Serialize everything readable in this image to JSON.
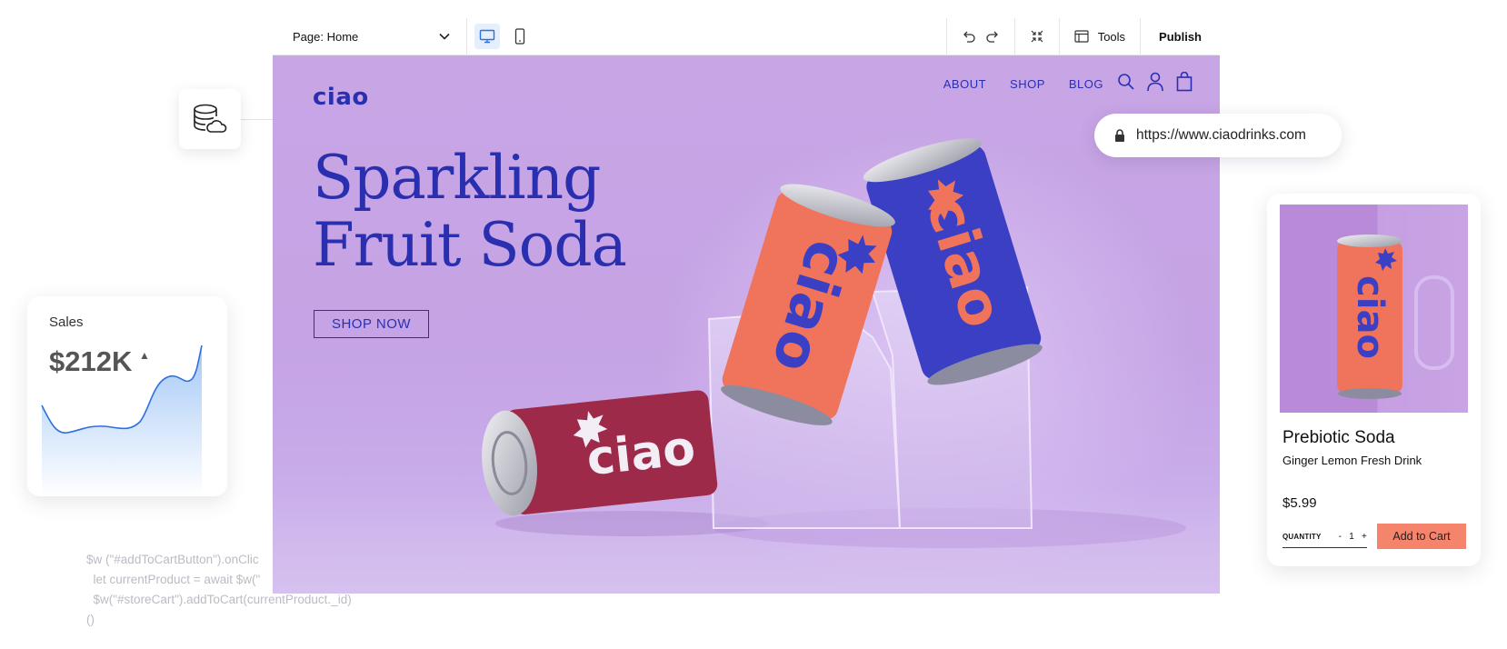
{
  "editor": {
    "page_select": "Page: Home",
    "tools_label": "Tools",
    "publish_label": "Publish"
  },
  "site": {
    "logo": "ciao",
    "nav": [
      "ABOUT",
      "SHOP",
      "BLOG"
    ],
    "headline_line1": "Sparkling",
    "headline_line2": "Fruit Soda",
    "cta": "SHOP NOW",
    "can_text": "ciao"
  },
  "browser": {
    "url": "https://www.ciaodrinks.com"
  },
  "sales_widget": {
    "label": "Sales",
    "value": "$212K",
    "trend": "▲"
  },
  "product_card": {
    "title": "Prebiotic Soda",
    "subtitle": "Ginger Lemon Fresh Drink",
    "price": "$5.99",
    "quantity_label": "QUANTITY",
    "quantity_minus": "-",
    "quantity_value": "1",
    "quantity_plus": "+",
    "add_to_cart": "Add to Cart"
  },
  "code_snippet": {
    "line1": "$w (\"#addToCartButton\").onClic",
    "line2": "  let currentProduct = await $w(\"",
    "line3": "  $w(\"#storeCart\").addToCart(currentProduct._id)",
    "line4": "()"
  },
  "colors": {
    "brand_blue": "#2a2fb0",
    "hero_purple": "#c8a6e6",
    "cart_button": "#f4846c",
    "can_red": "#f0735c",
    "can_blue": "#3b3fc4",
    "can_maroon": "#9e2a4a"
  }
}
